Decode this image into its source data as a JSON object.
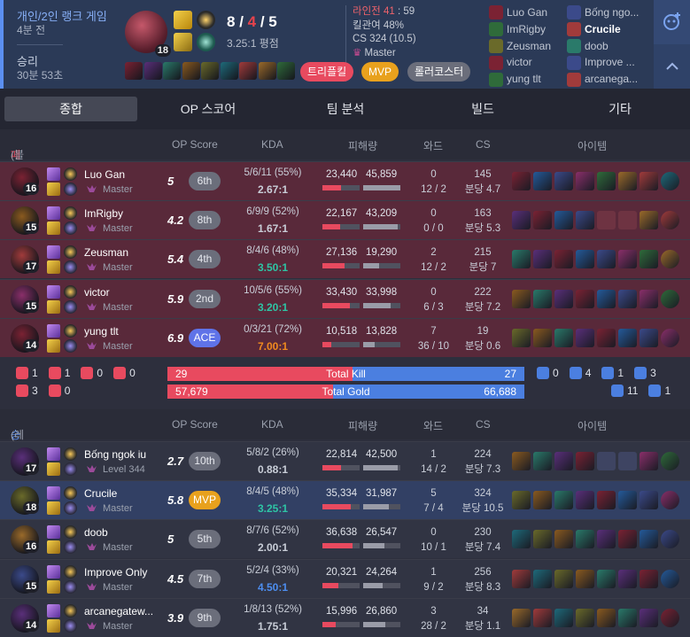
{
  "header": {
    "queue": "개인/2인 랭크 게임",
    "ago": "4분 전",
    "result": "승리",
    "duration": "30분 53초",
    "level": "18",
    "kda": {
      "k": "8",
      "d": "4",
      "a": "5"
    },
    "kda_ratio": "3.25:1 평점",
    "lane_label": "라인전",
    "lane_score": "41",
    "lane_sep": " : ",
    "lane_opp": "59",
    "kill_participation": "킬관여 48%",
    "cs": "CS 324 (10.5)",
    "tier": "Master",
    "tags": [
      "트리플킬",
      "MVP",
      "롤러코스터"
    ],
    "players_left": [
      "Luo Gan",
      "ImRigby",
      "Zeusman",
      "victor",
      "yung tlt"
    ],
    "players_right": [
      "Bống ngo...",
      "Crucile",
      "doob",
      "Improve ...",
      "arcanega..."
    ],
    "me": "Crucile"
  },
  "tabs": [
    "종합",
    "OP 스코어",
    "팀 분석",
    "빌드",
    "기타"
  ],
  "cols": {
    "opscore": "OP Score",
    "kda": "KDA",
    "dmg": "피해량",
    "ward": "와드",
    "cs": "CS",
    "items": "아이템"
  },
  "blue": {
    "title": "패배",
    "team": "(블루팀)",
    "players": [
      {
        "name": "Luo Gan",
        "tier": "Master",
        "lv": "16",
        "score": "5",
        "rank": "6th",
        "kda": "5/6/11 (55%)",
        "ratio": "2.67:1",
        "dealt": "23,440",
        "taken": "45,859",
        "ward1": "0",
        "ward2": "12 / 2",
        "cs1": "145",
        "cs2": "분당 4.7",
        "dp": 0.51,
        "tp": 1.0,
        "ratioColor": "#c9ced8"
      },
      {
        "name": "ImRigby",
        "tier": "Master",
        "lv": "15",
        "score": "4.2",
        "rank": "8th",
        "kda": "6/9/9 (52%)",
        "ratio": "1.67:1",
        "dealt": "22,167",
        "taken": "43,209",
        "ward1": "0",
        "ward2": "0 / 0",
        "cs1": "163",
        "cs2": "분당 5.3",
        "dp": 0.48,
        "tp": 0.94,
        "ratioColor": "#c9ced8"
      },
      {
        "name": "Zeusman",
        "tier": "Master",
        "lv": "17",
        "score": "5.4",
        "rank": "4th",
        "kda": "8/4/6 (48%)",
        "ratio": "3.50:1",
        "dealt": "27,136",
        "taken": "19,290",
        "ward1": "2",
        "ward2": "12 / 2",
        "cs1": "215",
        "cs2": "분당 7",
        "dp": 0.59,
        "tp": 0.42,
        "ratioColor": "#2ec5a5"
      },
      {
        "name": "victor",
        "tier": "Master",
        "lv": "15",
        "score": "5.9",
        "rank": "2nd",
        "kda": "10/5/6 (55%)",
        "ratio": "3.20:1",
        "dealt": "33,430",
        "taken": "33,998",
        "ward1": "0",
        "ward2": "6 / 3",
        "cs1": "222",
        "cs2": "분당 7.2",
        "dp": 0.73,
        "tp": 0.74,
        "ratioColor": "#2ec5a5"
      },
      {
        "name": "yung tlt",
        "tier": "Master",
        "lv": "14",
        "score": "6.9",
        "rank": "ACE",
        "kda": "0/3/21 (72%)",
        "ratio": "7.00:1",
        "dealt": "10,518",
        "taken": "13,828",
        "ward1": "7",
        "ward2": "36 / 10",
        "cs1": "19",
        "cs2": "분당 0.6",
        "dp": 0.23,
        "tp": 0.3,
        "ratioColor": "#f08a1f"
      }
    ]
  },
  "red": {
    "title": "승리",
    "team": "(레드팀)",
    "players": [
      {
        "name": "Bống ngok iu",
        "tier": "Level 344",
        "lv": "17",
        "score": "2.7",
        "rank": "10th",
        "kda": "5/8/2 (26%)",
        "ratio": "0.88:1",
        "dealt": "22,814",
        "taken": "42,500",
        "ward1": "1",
        "ward2": "14 / 2",
        "cs1": "224",
        "cs2": "분당 7.3",
        "dp": 0.5,
        "tp": 0.93,
        "ratioColor": "#c9ced8"
      },
      {
        "name": "Crucile",
        "tier": "Master",
        "lv": "18",
        "score": "5.8",
        "rank": "MVP",
        "kda": "8/4/5 (48%)",
        "ratio": "3.25:1",
        "dealt": "35,334",
        "taken": "31,987",
        "ward1": "5",
        "ward2": "7 / 4",
        "cs1": "324",
        "cs2": "분당 10.5",
        "dp": 0.77,
        "tp": 0.7,
        "ratioColor": "#2ec5a5"
      },
      {
        "name": "doob",
        "tier": "Master",
        "lv": "16",
        "score": "5",
        "rank": "5th",
        "kda": "8/7/6 (52%)",
        "ratio": "2.00:1",
        "dealt": "36,638",
        "taken": "26,547",
        "ward1": "0",
        "ward2": "10 / 1",
        "cs1": "230",
        "cs2": "분당 7.4",
        "dp": 0.8,
        "tp": 0.58,
        "ratioColor": "#c9ced8"
      },
      {
        "name": "Improve Only",
        "tier": "Master",
        "lv": "15",
        "score": "4.5",
        "rank": "7th",
        "kda": "5/2/4 (33%)",
        "ratio": "4.50:1",
        "dealt": "20,321",
        "taken": "24,264",
        "ward1": "1",
        "ward2": "9 / 2",
        "cs1": "256",
        "cs2": "분당 8.3",
        "dp": 0.44,
        "tp": 0.53,
        "ratioColor": "#4d8ef0"
      },
      {
        "name": "arcanegatew...",
        "tier": "Master",
        "lv": "14",
        "score": "3.9",
        "rank": "9th",
        "kda": "1/8/13 (52%)",
        "ratio": "1.75:1",
        "dealt": "15,996",
        "taken": "26,860",
        "ward1": "3",
        "ward2": "28 / 2",
        "cs1": "34",
        "cs2": "분당 1.1",
        "dp": 0.35,
        "tp": 0.59,
        "ratioColor": "#c9ced8"
      }
    ]
  },
  "totals": {
    "kill_label": "Total Kill",
    "gold_label": "Total Gold",
    "blue_kill": "29",
    "red_kill": "27",
    "blue_gold": "57,679",
    "red_gold": "66,688",
    "kill_frac": 0.518,
    "gold_frac": 0.464,
    "blue_obj": [
      "1",
      "1",
      "0",
      "0",
      "3",
      "0"
    ],
    "red_obj": [
      "0",
      "4",
      "1",
      "3",
      "11",
      "1"
    ]
  },
  "colors": {
    "loss": "#e84a5f",
    "win": "#4b7fe0",
    "accent": "#5b8ff0"
  }
}
